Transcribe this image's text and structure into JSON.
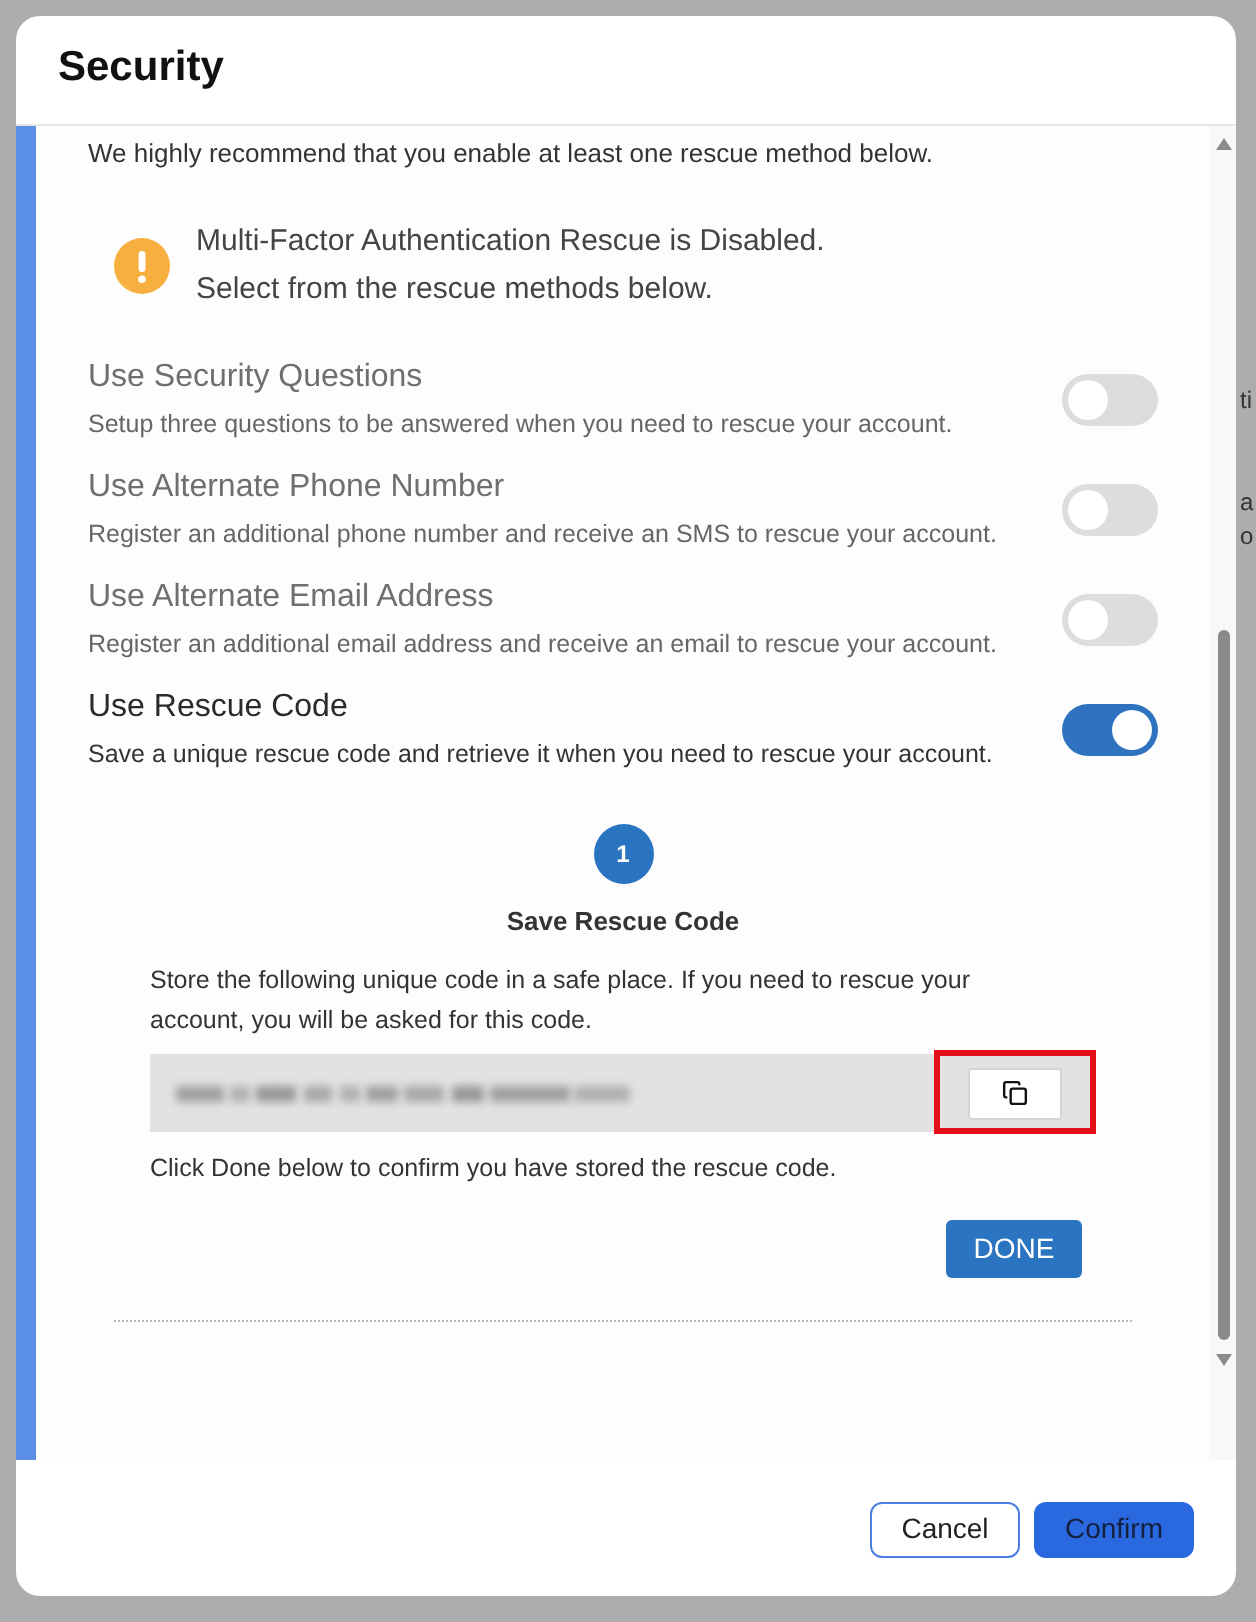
{
  "window": {
    "title": "Security"
  },
  "intro": "We highly recommend that you enable at least one rescue method below.",
  "alert": {
    "lines": [
      "Multi-Factor Authentication Rescue is Disabled.",
      "Select from the rescue methods below."
    ]
  },
  "methods": [
    {
      "title": "Use Security Questions",
      "description": "Setup three questions to be answered when you need to rescue your account.",
      "on": false
    },
    {
      "title": "Use Alternate Phone Number",
      "description": "Register an additional phone number and receive an SMS to rescue your account.",
      "on": false
    },
    {
      "title": "Use Alternate Email Address",
      "description": "Register an additional email address and receive an email to rescue your account.",
      "on": false
    },
    {
      "title": "Use Rescue Code",
      "description": "Save a unique rescue code and retrieve it when you need to rescue your account.",
      "on": true
    }
  ],
  "rescue_code": {
    "step": "1",
    "title": "Save Rescue Code",
    "instructions": "Store the following unique code in a safe place. If you need to rescue your account, you will be asked for this code.",
    "copy_button": {
      "highlighted": true
    },
    "note": "Click Done below to confirm you have stored the rescue code.",
    "done_button": "DONE"
  },
  "footer": {
    "buttons": [
      {
        "label": "Cancel",
        "kind": "secondary"
      },
      {
        "label": "Confirm",
        "kind": "primary"
      }
    ]
  },
  "background_text": [
    "ti",
    "a",
    "o"
  ]
}
